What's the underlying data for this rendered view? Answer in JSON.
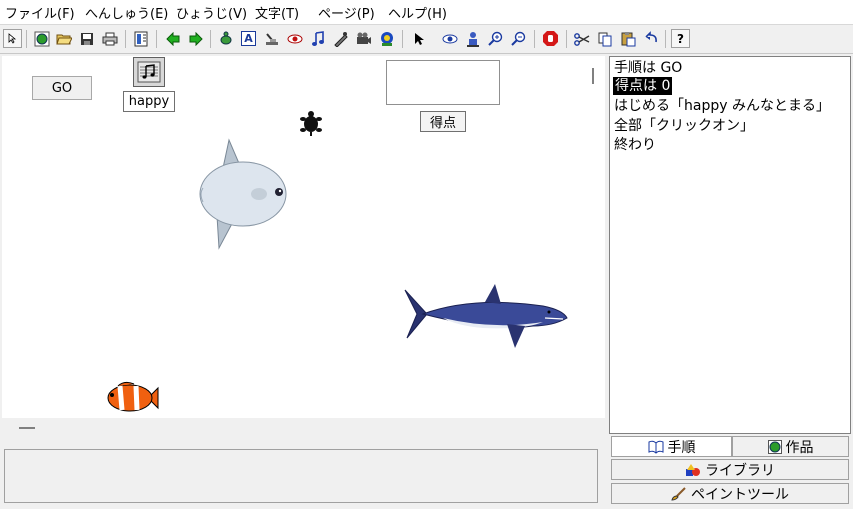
{
  "menu": [
    "ファイル(F)",
    "へんしゅう(E)",
    "ひょうじ(V)",
    "文字(T)",
    "ページ(P)",
    "ヘルプ(H)"
  ],
  "toolbar": {
    "tools": [
      "pointer",
      "globe",
      "open-folder",
      "save",
      "print",
      "layout",
      "arrow-left",
      "arrow-right",
      "turtle",
      "text",
      "stamp",
      "eye",
      "music",
      "pen",
      "camera",
      "sprite",
      "arrow-cursor",
      "look",
      "person",
      "zoom-in",
      "zoom-out",
      "stop",
      "cut",
      "copy",
      "paste",
      "undo",
      "help"
    ],
    "text_tool_label": "A",
    "help_label": "?"
  },
  "stage": {
    "go_button": "GO",
    "sound_label": "happy",
    "score_button": "得点",
    "score_value": ""
  },
  "script": {
    "lines": [
      "手順は GO",
      "得点は 0",
      "はじめる「happy みんなとまる」",
      "全部「クリックオン」",
      "終わり"
    ]
  },
  "tabs": {
    "procedures": "手順",
    "projects": "作品",
    "library": "ライブラリ",
    "paint_tool": "ペイントツール"
  },
  "colors": {
    "accent_selection": "#000000",
    "stage_background": "#ffffff",
    "window_background": "#f0f0f0"
  }
}
